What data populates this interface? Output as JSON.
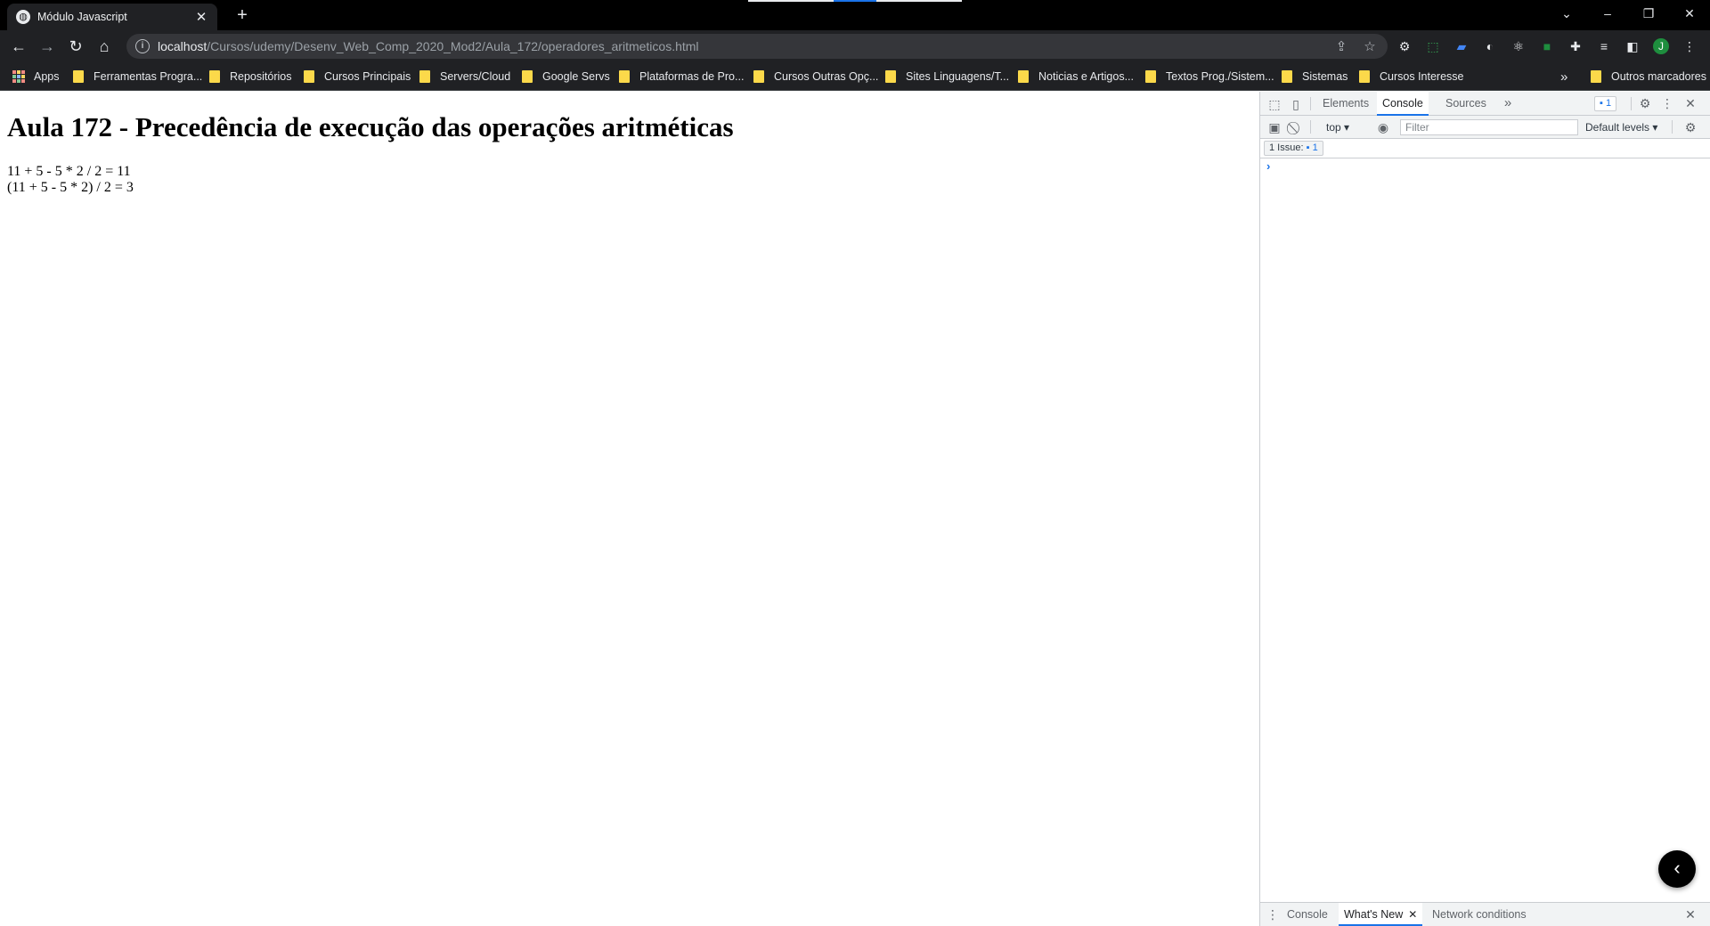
{
  "tab": {
    "favicon": "globe-icon",
    "title": "Módulo Javascript",
    "close_glyph": "✕",
    "new_tab_glyph": "+"
  },
  "window_controls": {
    "tab_search_glyph": "⌄",
    "minimize_glyph": "–",
    "restore_glyph": "❐",
    "close_glyph": "✕"
  },
  "toolbar": {
    "back_glyph": "←",
    "forward_glyph": "→",
    "reload_glyph": "↻",
    "home_glyph": "⌂",
    "info_glyph": "i",
    "url_host": "localhost",
    "url_path": "/Cursos/udemy/Desenv_Web_Comp_2020_Mod2/Aula_172/operadores_aritmeticos.html",
    "share_glyph": "⇪",
    "star_glyph": "☆",
    "avatar_letter": "J",
    "menu_glyph": "⋮",
    "extensions": [
      "gear-extension-icon",
      "screenshot-extension-icon",
      "translate-extension-icon",
      "dark-mode-extension-icon",
      "react-extension-icon",
      "green-square-extension-icon",
      "puzzle-icon",
      "media-queue-icon",
      "side-panel-icon"
    ]
  },
  "bookmarks": {
    "apps_label": "Apps",
    "items": [
      "Ferramentas Progra...",
      "Repositórios",
      "Cursos Principais",
      "Servers/Cloud",
      "Google Servs",
      "Plataformas de Pro...",
      "Cursos Outras Opç...",
      "Sites Linguagens/T...",
      "Noticias e Artigos...",
      "Textos Prog./Sistem...",
      "Sistemas",
      "Cursos Interesse"
    ],
    "overflow_glyph": "»",
    "other_label": "Outros marcadores"
  },
  "page": {
    "heading": "Aula 172 - Precedência de execução das operações aritméticas",
    "lines": [
      "11 + 5 - 5 * 2 / 2 = 11",
      "(11 + 5 - 5 * 2) / 2 = 3"
    ]
  },
  "devtools": {
    "tabs": [
      "Elements",
      "Console",
      "Sources"
    ],
    "active_tab": "Console",
    "more_tabs_glyph": "»",
    "issues_badge_count": "1",
    "context": "top",
    "filter_placeholder": "Filter",
    "levels_label": "Default levels",
    "issues_label": "1 Issue:",
    "issues_count": "1",
    "prompt_caret": "›",
    "drawer_tabs": [
      "Console",
      "What's New",
      "Network conditions"
    ],
    "drawer_active": "What's New",
    "fab_glyph": "‹"
  },
  "colors": {
    "chrome_dark": "#202124",
    "tab_strip": "#000000",
    "accent": "#1a73e8",
    "folder": "#fcd94a"
  }
}
